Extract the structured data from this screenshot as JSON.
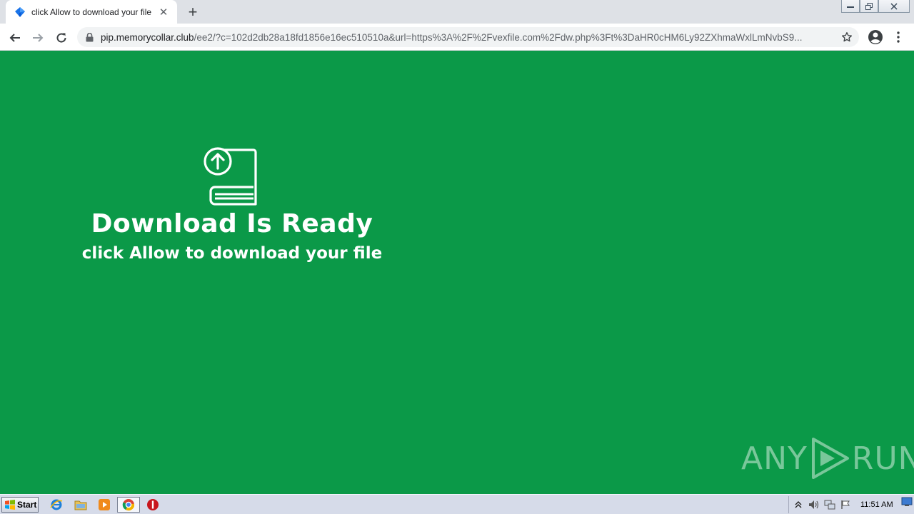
{
  "browser": {
    "tab": {
      "title": "click Allow to download your file",
      "close_glyph": "✕",
      "favicon": "blue-diamond-icon"
    },
    "new_tab_glyph": "+",
    "window_controls": {
      "minimize_glyph": "—",
      "restore_glyph": "❐",
      "close_glyph": "✕"
    },
    "url": {
      "host": "pip.memorycollar.club",
      "rest": "/ee2/?c=102d2db28a18fd1856e16ec510510a&url=https%3A%2F%2Fvexfile.com%2Fdw.php%3Ft%3DaHR0cHM6Ly92ZXhmaWxlLmNvbS9..."
    }
  },
  "page": {
    "headline": "Download Is Ready",
    "subline": "click Allow to download your file",
    "background_color": "#0b9948",
    "watermark": {
      "left": "ANY",
      "right": "RUN"
    }
  },
  "taskbar": {
    "start_label": "Start",
    "clock": "11:51 AM"
  }
}
